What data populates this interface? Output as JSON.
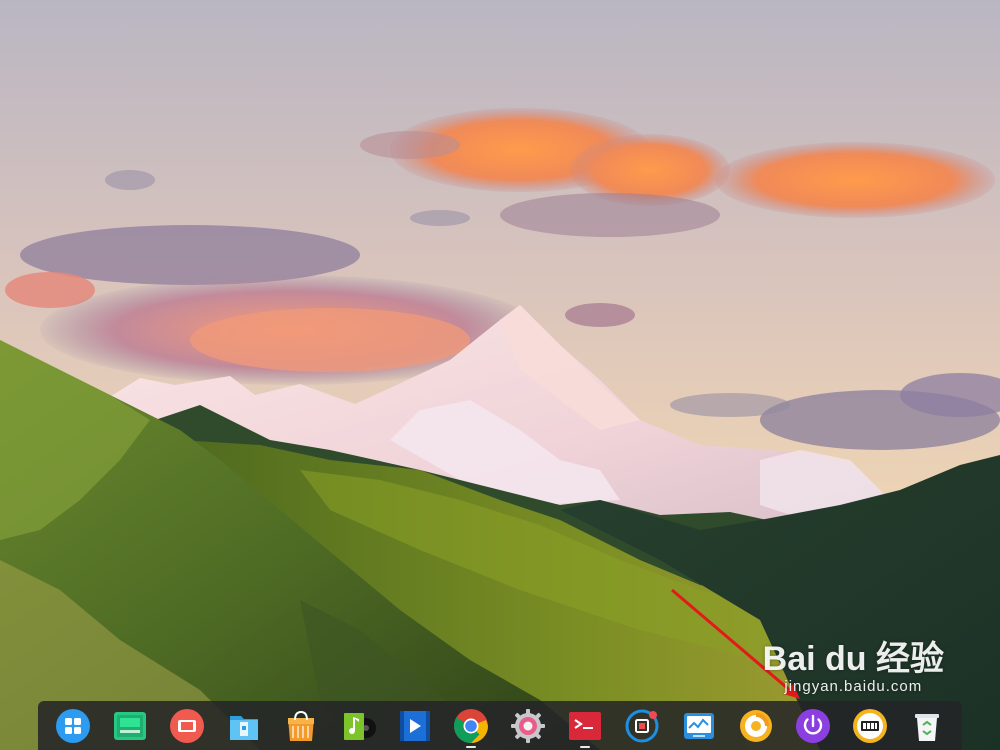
{
  "watermark": {
    "logo_text": "Bai du 经验",
    "sub_text": "jingyan.baidu.com"
  },
  "dock": {
    "items": [
      {
        "name": "launcher",
        "icon": "launcher-icon",
        "running": false
      },
      {
        "name": "multitasking-view",
        "icon": "multitask-icon",
        "running": false
      },
      {
        "name": "screen-recorder",
        "icon": "recorder-icon",
        "running": false
      },
      {
        "name": "file-manager",
        "icon": "file-manager-icon",
        "running": false
      },
      {
        "name": "app-store",
        "icon": "app-store-icon",
        "running": false
      },
      {
        "name": "music",
        "icon": "music-icon",
        "running": false
      },
      {
        "name": "video-player",
        "icon": "video-icon",
        "running": false
      },
      {
        "name": "chrome",
        "icon": "chrome-icon",
        "running": true
      },
      {
        "name": "control-center",
        "icon": "settings-gear-icon",
        "running": false
      },
      {
        "name": "terminal",
        "icon": "terminal-icon",
        "running": true
      },
      {
        "name": "screenshot",
        "icon": "screenshot-icon",
        "running": false
      },
      {
        "name": "system-monitor",
        "icon": "system-monitor-icon",
        "running": false
      },
      {
        "name": "browser-download",
        "icon": "downloader-icon",
        "running": false
      },
      {
        "name": "power",
        "icon": "power-icon",
        "running": false
      },
      {
        "name": "clock",
        "icon": "clock-icon",
        "running": false
      },
      {
        "name": "trash",
        "icon": "trash-icon",
        "running": false
      }
    ]
  }
}
